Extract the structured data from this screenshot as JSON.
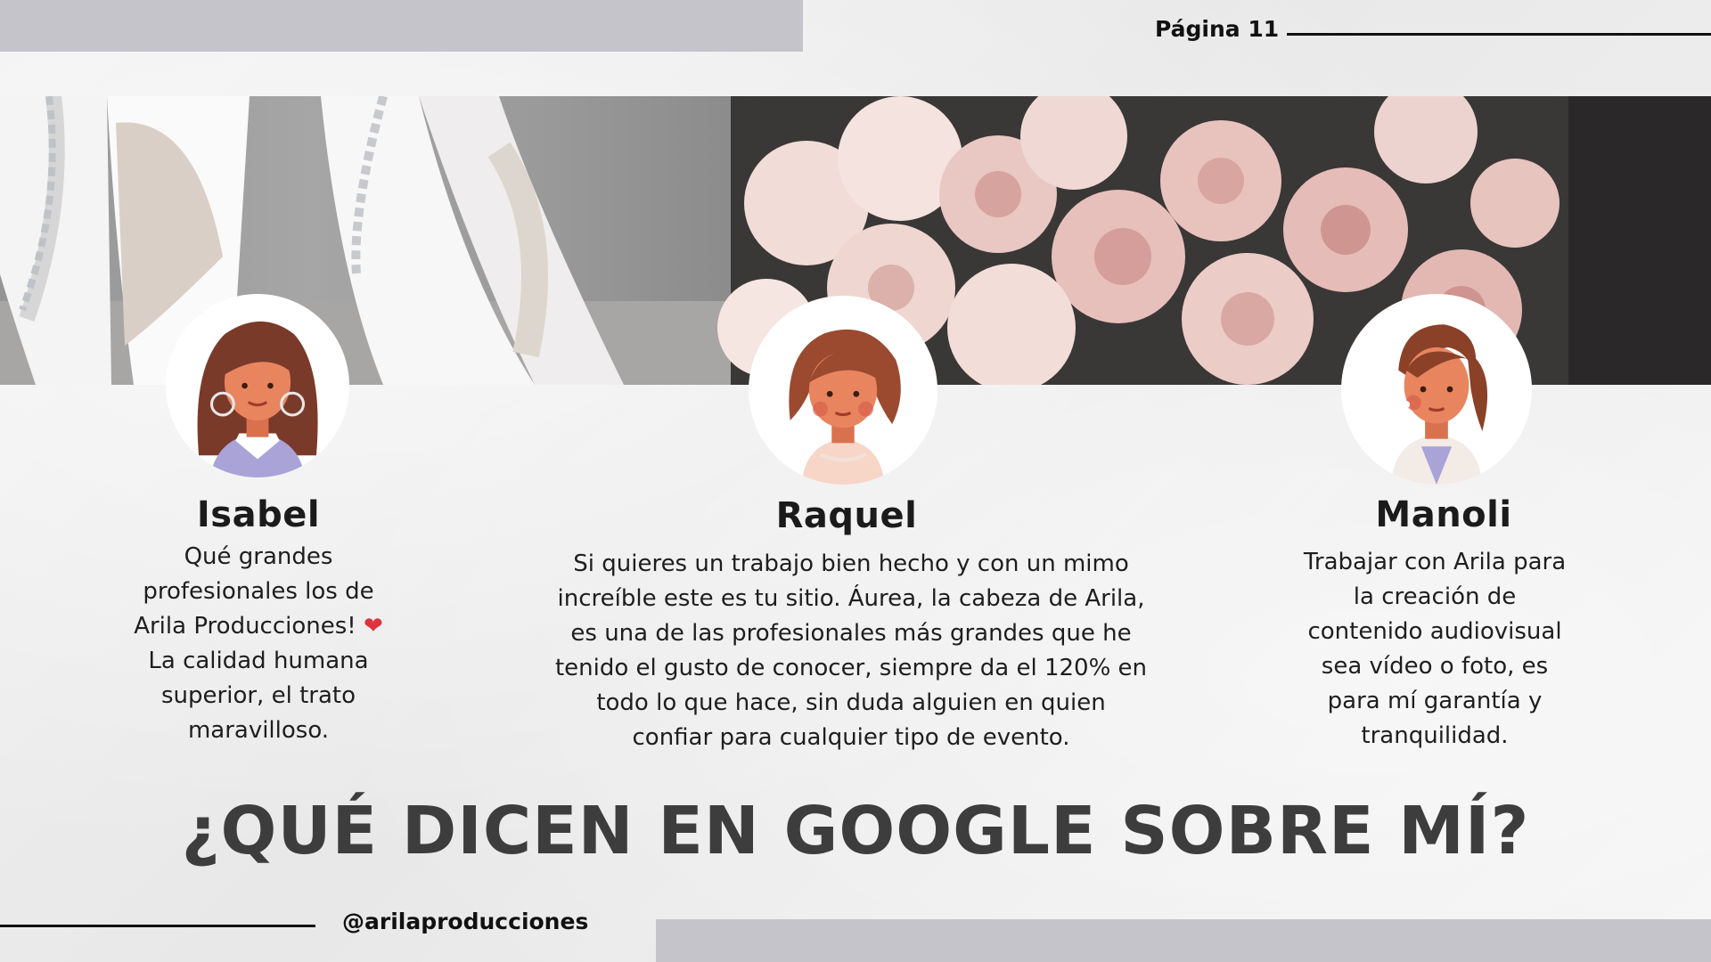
{
  "header": {
    "page_label": "Página 11"
  },
  "testimonials": [
    {
      "name": "Isabel",
      "lines": [
        "Qué grandes",
        "profesionales los de",
        "Arila Producciones!",
        "La calidad humana",
        "superior, el trato",
        "maravilloso."
      ],
      "emoji": "❤"
    },
    {
      "name": "Raquel",
      "lines": [
        "Si quieres un trabajo bien hecho y con un mimo",
        "increíble este es tu sitio. Áurea, la cabeza de Arila,",
        "es una de las profesionales más grandes que he",
        "tenido el gusto de conocer, siempre da el 120% en",
        "todo lo que hace, sin duda alguien en quien",
        "confiar para cualquier tipo de evento."
      ]
    },
    {
      "name": "Manoli",
      "lines": [
        "Trabajar con Arila para",
        "la creación de",
        "contenido audiovisual",
        "sea vídeo o foto, es",
        "para mí garantía y",
        "tranquilidad."
      ]
    }
  ],
  "headline": "¿QUÉ DICEN EN GOOGLE SOBRE MÍ?",
  "footer": {
    "handle": "@arilaproducciones"
  },
  "colors": {
    "bar": "#c6c4cb",
    "heart": "#e0313d",
    "headline": "#3d3d3d"
  },
  "icons": {
    "hero": "wedding-shoes-and-roses-photo",
    "avatars": [
      "woman-avatar-hoop-earrings",
      "woman-avatar-bob-hair",
      "woman-avatar-ponytail"
    ]
  }
}
